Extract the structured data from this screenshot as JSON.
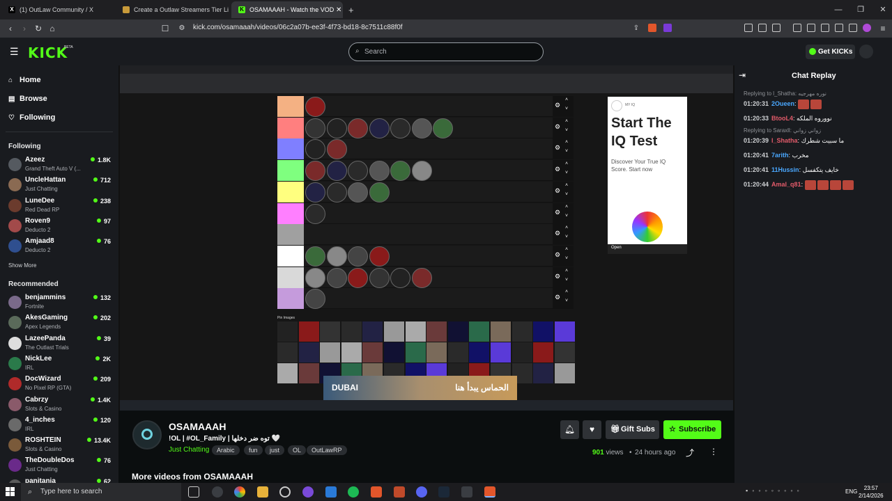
{
  "browser": {
    "tabs": [
      {
        "label": "(1) OutLaw Community / X"
      },
      {
        "label": "Create a Outlaw Streamers Tier List"
      },
      {
        "label": "OSAMAAAH - Watch the VOD"
      }
    ],
    "url": "kick.com/osamaaah/videos/06c2a07b-ee3f-4f73-bd18-8c7511c88f0f"
  },
  "header": {
    "logo": "KICK",
    "beta": "BETA",
    "search_placeholder": "Search",
    "get_kicks": "Get KICKs"
  },
  "sidebar": {
    "nav": [
      {
        "label": "Home",
        "icon": "home-icon"
      },
      {
        "label": "Browse",
        "icon": "browse-icon"
      },
      {
        "label": "Following",
        "icon": "heart-icon"
      }
    ],
    "following_heading": "Following",
    "following": [
      {
        "name": "Azeez",
        "game": "Grand Theft Auto V (...",
        "viewers": "1.8K",
        "color": "#555a60"
      },
      {
        "name": "UncleHattan",
        "game": "Just Chatting",
        "viewers": "712",
        "color": "#8a6a52"
      },
      {
        "name": "LuneDee",
        "game": "Red Dead RP",
        "viewers": "238",
        "color": "#6b3b2d"
      },
      {
        "name": "Roven9",
        "game": "Deducto 2",
        "viewers": "97",
        "color": "#a24a4a"
      },
      {
        "name": "Amjaad8",
        "game": "Deducto 2",
        "viewers": "76",
        "color": "#2f4f8f"
      }
    ],
    "show_more": "Show More",
    "recommended_heading": "Recommended",
    "recommended": [
      {
        "name": "benjammins",
        "game": "Fortnite",
        "viewers": "132",
        "color": "#7a6a8a"
      },
      {
        "name": "AkesGaming",
        "game": "Apex Legends",
        "viewers": "202",
        "color": "#5a6a5a"
      },
      {
        "name": "LazeePanda",
        "game": "The Outlast Trials",
        "viewers": "39",
        "color": "#ddd"
      },
      {
        "name": "NickLee",
        "game": "IRL",
        "viewers": "2K",
        "color": "#2a7a4a"
      },
      {
        "name": "DocWizard",
        "game": "No Pixel RP (GTA)",
        "viewers": "209",
        "color": "#b02a2a"
      },
      {
        "name": "Cabrzy",
        "game": "Slots & Casino",
        "viewers": "1.4K",
        "color": "#8a5a6a"
      },
      {
        "name": "4_inches",
        "game": "IRL",
        "viewers": "120",
        "color": "#6a6a6a"
      },
      {
        "name": "ROSHTEIN",
        "game": "Slots & Casino",
        "viewers": "13.4K",
        "color": "#7a5a3a"
      },
      {
        "name": "TheDoubleDos",
        "game": "Just Chatting",
        "viewers": "76",
        "color": "#6a2a8a"
      },
      {
        "name": "panitania",
        "game": "",
        "viewers": "62",
        "color": "#5a5a5a"
      }
    ]
  },
  "video": {
    "ad": {
      "brand": "MY IQ",
      "title": "Start The IQ Test",
      "subtitle": "Discover Your True IQ Score. Start now",
      "open": "Open"
    },
    "banner": {
      "left": "DUBAI",
      "right": "الحماس يبدأ هنا"
    },
    "pin_images": "Pin Images"
  },
  "stream": {
    "name": "OSAMAAAH",
    "title": "!OL | #OL_Family | توه ضر دخلها 🤍",
    "category": "Just Chatting",
    "tags": [
      "Arabic",
      "fun",
      "just",
      "OL",
      "OutLawRP"
    ],
    "gift_subs": "Gift Subs",
    "subscribe": "Subscribe",
    "views_count": "901",
    "views_label": "views",
    "ago": "24 hours ago",
    "more_videos": "More videos from OSAMAAAH"
  },
  "chat": {
    "title": "Chat Replay",
    "messages": [
      {
        "reply": "Replying to l_Shatha: نوره مهرجيه",
        "time": "01:20:31",
        "user": "2Oueen",
        "color": "#4aa8ff",
        "text": "",
        "emotes": 2
      },
      {
        "time": "01:20:33",
        "user": "BtooL4",
        "color": "#e35b6a",
        "text": "نووروه الملكه",
        "emotes": 0
      },
      {
        "reply": "Replying to Saraxll: زواني زواني",
        "time": "01:20:39",
        "user": "l_Shatha",
        "color": "#e35b6a",
        "text": "ما سبيت شطرك",
        "emotes": 0
      },
      {
        "time": "01:20:41",
        "user": "7arith",
        "color": "#4aa8ff",
        "text": "مخرب",
        "emotes": 0
      },
      {
        "time": "01:20:41",
        "user": "11Hussin",
        "color": "#4aa8ff",
        "text": "خايف يتكفسل",
        "emotes": 0
      },
      {
        "time": "01:20:44",
        "user": "Amal_q81",
        "color": "#e35b6a",
        "text": "",
        "emotes": 4
      }
    ]
  },
  "taskbar": {
    "search": "Type here to search",
    "lang": "ENG",
    "time": "23:57",
    "date": "2/14/2026"
  }
}
